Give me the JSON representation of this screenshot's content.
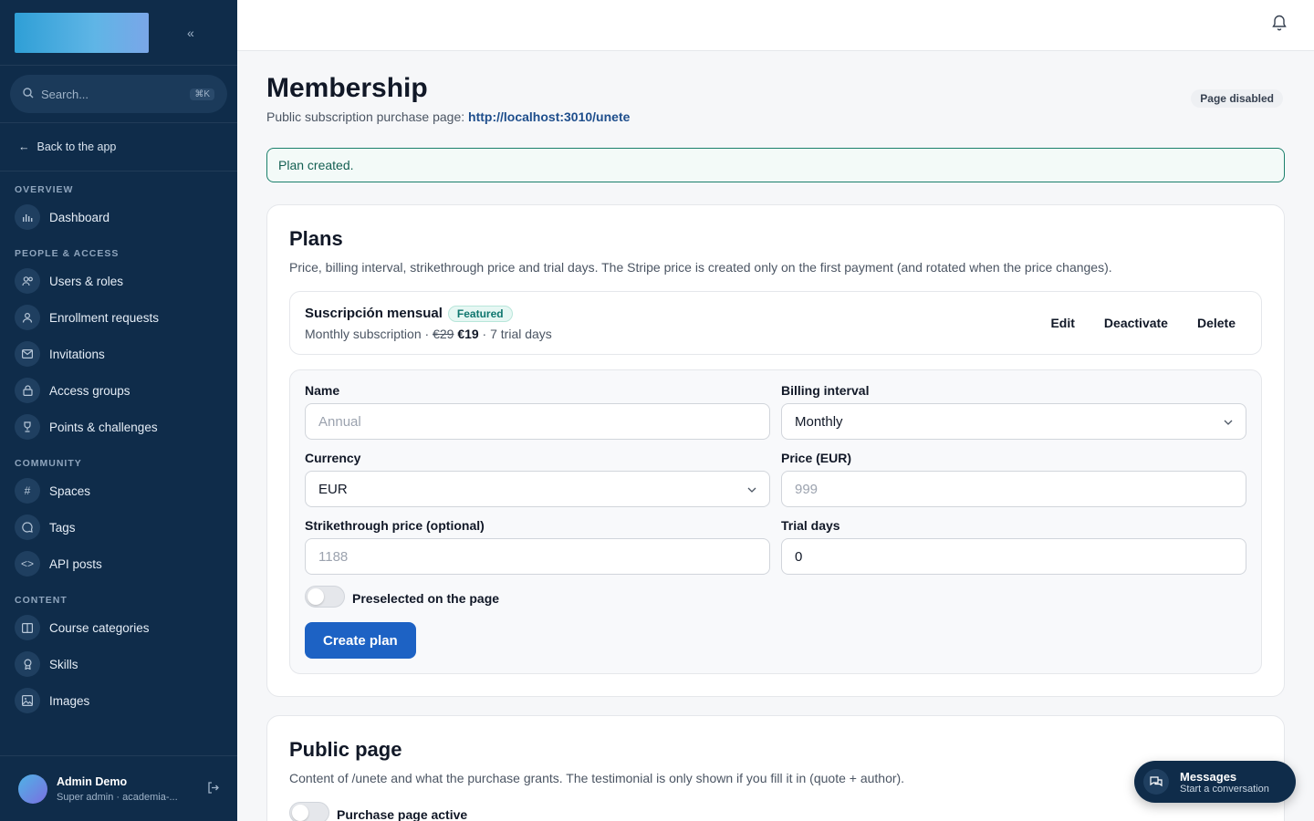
{
  "sidebar": {
    "search_placeholder": "Search...",
    "search_shortcut": "⌘K",
    "back_label": "Back to the app",
    "sections": {
      "overview": "OVERVIEW",
      "people": "PEOPLE & ACCESS",
      "community": "COMMUNITY",
      "content": "CONTENT"
    },
    "items": {
      "dashboard": "Dashboard",
      "users": "Users & roles",
      "enrollment": "Enrollment requests",
      "invitations": "Invitations",
      "access_groups": "Access groups",
      "points": "Points & challenges",
      "spaces": "Spaces",
      "tags": "Tags",
      "api_posts": "API posts",
      "course_categories": "Course categories",
      "skills": "Skills",
      "images": "Images"
    },
    "user": {
      "name": "Admin Demo",
      "role": "Super admin · academia-..."
    }
  },
  "page": {
    "title": "Membership",
    "subtitle_prefix": "Public subscription purchase page: ",
    "subtitle_link": "http://localhost:3010/unete",
    "status_badge": "Page disabled",
    "alert": "Plan created."
  },
  "plans": {
    "title": "Plans",
    "description": "Price, billing interval, strikethrough price and trial days. The Stripe price is created only on the first payment (and rotated when the price changes).",
    "plan": {
      "name": "Suscripción mensual",
      "badge": "Featured",
      "interval": "Monthly subscription · ",
      "old_price": "€29",
      "price": "€19",
      "trial": " · 7 trial days",
      "edit": "Edit",
      "deactivate": "Deactivate",
      "delete": "Delete"
    },
    "form": {
      "name_label": "Name",
      "name_placeholder": "Annual",
      "interval_label": "Billing interval",
      "interval_value": "Monthly",
      "currency_label": "Currency",
      "currency_value": "EUR",
      "price_label": "Price (EUR)",
      "price_placeholder": "999",
      "strike_label": "Strikethrough price (optional)",
      "strike_placeholder": "1188",
      "trial_label": "Trial days",
      "trial_value": "0",
      "preselected_label": "Preselected on the page",
      "create_button": "Create plan"
    }
  },
  "public_page": {
    "title": "Public page",
    "description": "Content of /unete and what the purchase grants. The testimonial is only shown if you fill it in (quote + author).",
    "active_label": "Purchase page active"
  },
  "messages": {
    "title": "Messages",
    "subtitle": "Start a conversation"
  }
}
